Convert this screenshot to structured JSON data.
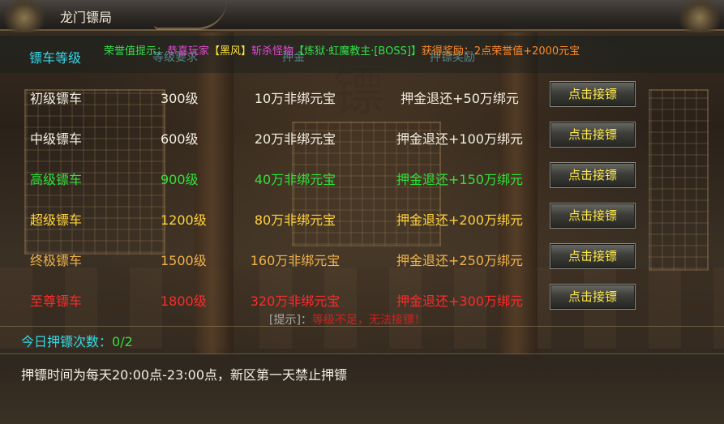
{
  "window": {
    "title": "龙门镖局"
  },
  "header": {
    "level_label": "镖车等级",
    "notice": [
      {
        "text": "荣誉值提示：",
        "color": "#33e04a"
      },
      {
        "text": "恭喜玩家",
        "color": "#e64ad6"
      },
      {
        "text": "【黑风】",
        "color": "#ffe23a"
      },
      {
        "text": "斩杀怪物",
        "color": "#e64ad6"
      },
      {
        "text": "【炼狱·虹魔教主·[BOSS]】",
        "color": "#33e04a"
      },
      {
        "text": "获得奖励：",
        "color": "#ff8a2a"
      },
      {
        "text": "2点荣誉值+2000元宝",
        "color": "#ff8a2a"
      }
    ],
    "columns": [
      "等级要求",
      "押金",
      "押镖奖励"
    ]
  },
  "rows": [
    {
      "name": "初级镖车",
      "level": "300级",
      "deposit": "10万非绑元宝",
      "reward": "押金退还+50万绑元",
      "button": "点击接镖",
      "color": "#f4efe2"
    },
    {
      "name": "中级镖车",
      "level": "600级",
      "deposit": "20万非绑元宝",
      "reward": "押金退还+100万绑元",
      "button": "点击接镖",
      "color": "#f4efe2"
    },
    {
      "name": "高级镖车",
      "level": "900级",
      "deposit": "40万非绑元宝",
      "reward": "押金退还+150万绑元",
      "button": "点击接镖",
      "color": "#2fe23a"
    },
    {
      "name": "超级镖车",
      "level": "1200级",
      "deposit": "80万非绑元宝",
      "reward": "押金退还+200万绑元",
      "button": "点击接镖",
      "color": "#ffd23a"
    },
    {
      "name": "终极镖车",
      "level": "1500级",
      "deposit": "160万非绑元宝",
      "reward": "押金退还+250万绑元",
      "button": "点击接镖",
      "color": "#f0b24a"
    },
    {
      "name": "至尊镖车",
      "level": "1800级",
      "deposit": "320万非绑元宝",
      "reward": "押金退还+300万绑元",
      "button": "点击接镖",
      "color": "#ff2a2a"
    }
  ],
  "tip": {
    "prefix": "[提示]：",
    "text": "等级不足，无法接镖！",
    "prefix_color": "#a9a9a9",
    "text_color": "#d02020"
  },
  "today": {
    "label": "今日押镖次数：",
    "value": "0/2",
    "label_color": "#35d8e6",
    "value_color": "#2fe23a"
  },
  "footer": {
    "info": "押镖时间为每天20:00点-23:00点，新区第一天禁止押镖"
  }
}
